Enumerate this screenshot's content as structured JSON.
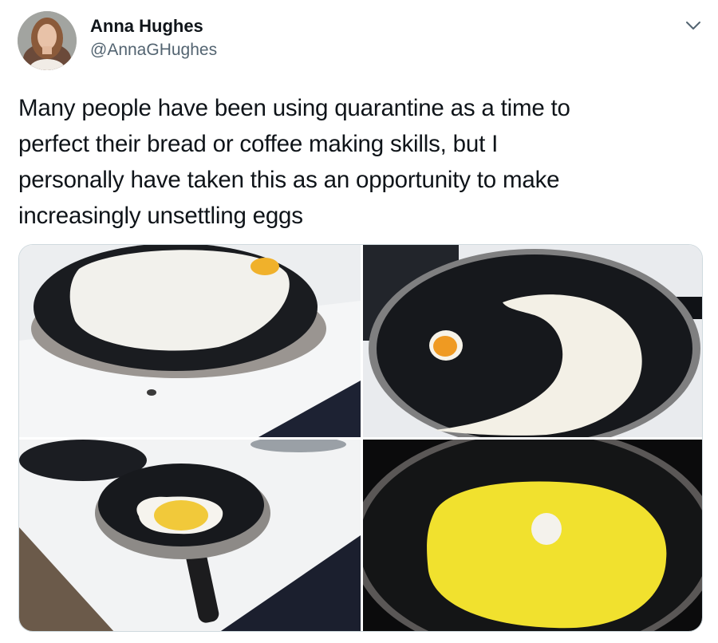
{
  "tweet": {
    "author_name": "Anna Hughes",
    "author_handle": "@AnnaGHughes",
    "avatar_icon": "profile-photo",
    "menu_icon": "chevron-down-icon",
    "text": "Many people have been using quarantine as a time to perfect their bread or coffee making skills, but I personally have taken this as an opportunity to make increasingly unsettling eggs",
    "text_lines": [
      "Many people have been using quarantine as a time to",
      "perfect their bread or coffee making skills, but I",
      "personally have taken this as an opportunity to make",
      "increasingly unsettling eggs"
    ]
  },
  "media": {
    "photos": [
      "egg-pancake-in-pan-photo",
      "crescent-moon-egg-photo",
      "yolk-in-small-pan-photo",
      "giant-yolk-small-white-photo"
    ]
  }
}
